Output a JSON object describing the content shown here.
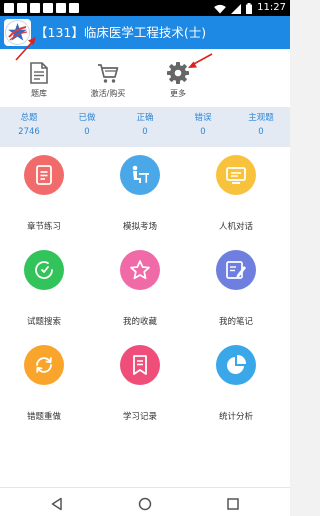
{
  "status_bar": {
    "time": "11:27",
    "icons": [
      "notification-icon",
      "notification-icon",
      "notification-icon",
      "notification-icon",
      "notification-icon",
      "notification-icon",
      "wifi-icon",
      "signal-icon",
      "battery-icon"
    ]
  },
  "header": {
    "logo_icon": "app-logo-icon",
    "title": "【131】临床医学工程技术(士)",
    "background": "#1e88e5"
  },
  "toolbar": {
    "items": [
      {
        "label": "题库",
        "icon": "document-icon"
      },
      {
        "label": "激活/购买",
        "icon": "cart-icon"
      },
      {
        "label": "更多",
        "icon": "gear-icon"
      }
    ]
  },
  "stats": [
    {
      "label": "总题",
      "value": "2746"
    },
    {
      "label": "已做",
      "value": "0"
    },
    {
      "label": "正确",
      "value": "0"
    },
    {
      "label": "错误",
      "value": "0"
    },
    {
      "label": "主观题",
      "value": "0"
    }
  ],
  "grid": {
    "items": [
      {
        "label": "章节练习",
        "icon": "document-icon",
        "color": "#f26b6b"
      },
      {
        "label": "模拟考场",
        "icon": "exam-desk-icon",
        "color": "#4aa8e8"
      },
      {
        "label": "人机对话",
        "icon": "monitor-icon",
        "color": "#f9c23c"
      },
      {
        "label": "试题搜索",
        "icon": "search-icon",
        "color": "#32c35a"
      },
      {
        "label": "我的收藏",
        "icon": "star-icon",
        "color": "#f06aa8"
      },
      {
        "label": "我的笔记",
        "icon": "note-edit-icon",
        "color": "#6f7fe0"
      },
      {
        "label": "错题重做",
        "icon": "redo-icon",
        "color": "#f9a42a"
      },
      {
        "label": "学习记录",
        "icon": "bookmark-icon",
        "color": "#ef4e7a"
      },
      {
        "label": "统计分析",
        "icon": "pie-chart-icon",
        "color": "#3aa8e8"
      }
    ]
  },
  "nav_bar": {
    "icons": [
      "back-icon",
      "home-icon",
      "recent-apps-icon"
    ]
  }
}
